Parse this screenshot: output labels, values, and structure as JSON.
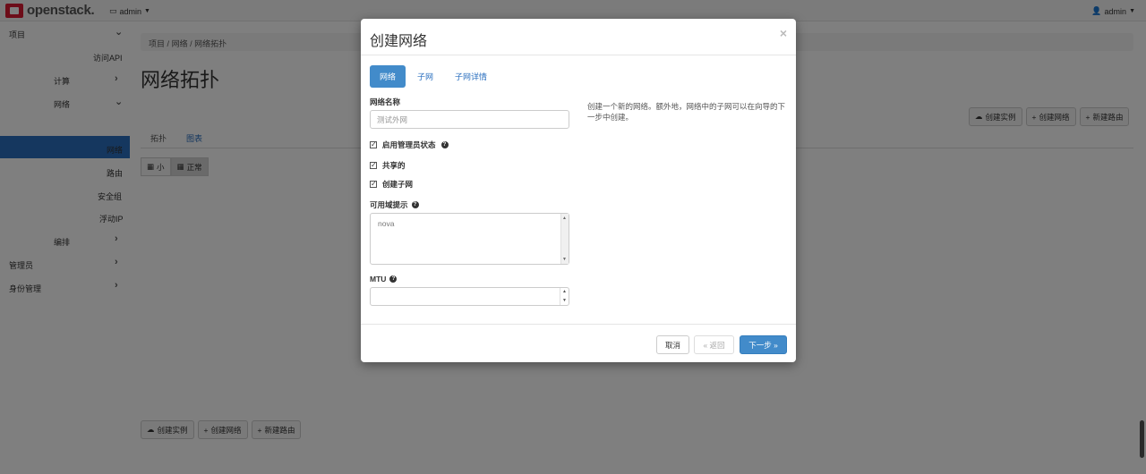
{
  "topbar": {
    "brand": "openstack.",
    "project": "admin",
    "user": "admin"
  },
  "sidebar": {
    "items": [
      {
        "label": "项目"
      },
      {
        "label": "访问API"
      },
      {
        "label": "计算"
      },
      {
        "label": "网络"
      },
      {
        "label": "网络拓扑"
      },
      {
        "label": "网络"
      },
      {
        "label": "路由"
      },
      {
        "label": "安全组"
      },
      {
        "label": "浮动IP"
      },
      {
        "label": "编排"
      },
      {
        "label": "管理员"
      },
      {
        "label": "身份管理"
      }
    ]
  },
  "main": {
    "breadcrumb": [
      "项目",
      "网络",
      "网络拓扑"
    ],
    "breadcrumb_sep": "/",
    "title": "网络拓扑",
    "tabs": [
      "拓扑",
      "图表"
    ],
    "size_buttons": [
      "小",
      "正常"
    ],
    "actions": [
      "创建实例",
      "创建网络",
      "新建路由"
    ]
  },
  "modal": {
    "title": "创建网络",
    "close": "×",
    "tabs": [
      "网络",
      "子网",
      "子网详情"
    ],
    "network_name_label": "网络名称",
    "network_name_placeholder": "测试外网",
    "checkboxes": [
      {
        "label": "启用管理员状态",
        "checked": true,
        "help": true
      },
      {
        "label": "共享的",
        "checked": true,
        "help": false
      },
      {
        "label": "创建子网",
        "checked": true,
        "help": false
      }
    ],
    "az_label": "可用域提示",
    "az_value": "nova",
    "mtu_label": "MTU",
    "mtu_value": "",
    "help_text": "创建一个新的网络。额外地，网络中的子网可以在向导的下一步中创建。",
    "buttons": {
      "cancel": "取消",
      "back": "« 返回",
      "next": "下一步 »"
    }
  },
  "colors": {
    "brand": "#da1a32",
    "primary": "#428bca",
    "sidebar_active": "#2a6fbf"
  }
}
